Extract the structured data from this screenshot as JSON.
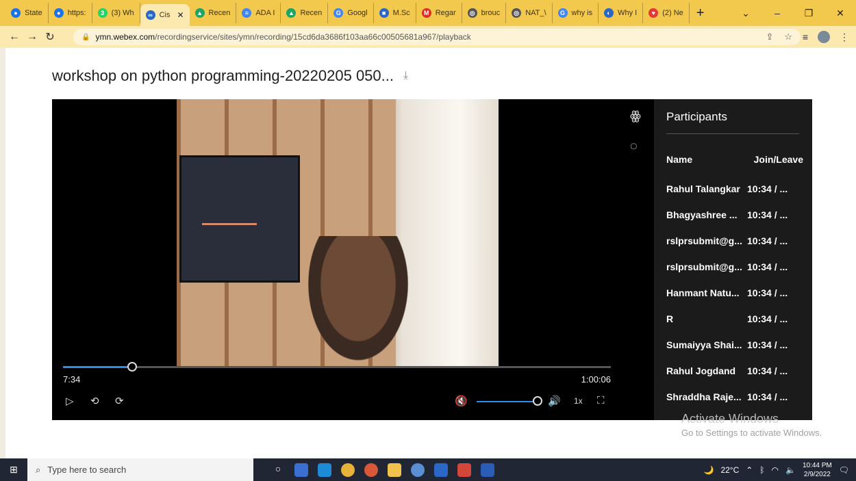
{
  "browser": {
    "tabs": [
      {
        "label": "State",
        "fav_color": "#1a73e8",
        "fav_glyph": "●"
      },
      {
        "label": "https:",
        "fav_color": "#1a73e8",
        "fav_glyph": "●"
      },
      {
        "label": "(3) Wh",
        "fav_color": "#25d366",
        "fav_glyph": "3"
      },
      {
        "label": "Cis",
        "fav_color": "#2b67c6",
        "fav_glyph": "∞",
        "active": true
      },
      {
        "label": "Recen",
        "fav_color": "#1fa463",
        "fav_glyph": "▲"
      },
      {
        "label": "ADA I",
        "fav_color": "#4285f4",
        "fav_glyph": "≡"
      },
      {
        "label": "Recen",
        "fav_color": "#1fa463",
        "fav_glyph": "▲"
      },
      {
        "label": "Googl",
        "fav_color": "#4285f4",
        "fav_glyph": "G"
      },
      {
        "label": "M.Sc",
        "fav_color": "#2b67c6",
        "fav_glyph": "■"
      },
      {
        "label": "Regar",
        "fav_color": "#d93025",
        "fav_glyph": "M"
      },
      {
        "label": "brouc",
        "fav_color": "#555555",
        "fav_glyph": "◎"
      },
      {
        "label": "NAT_\\",
        "fav_color": "#555555",
        "fav_glyph": "◎"
      },
      {
        "label": "why is",
        "fav_color": "#4285f4",
        "fav_glyph": "G"
      },
      {
        "label": "Why I",
        "fav_color": "#2b67c6",
        "fav_glyph": "◐"
      },
      {
        "label": "(2) Ne",
        "fav_color": "#e53935",
        "fav_glyph": "♥"
      }
    ],
    "new_tab": "+",
    "url_host": "ymn.webex.com",
    "url_path": "/recordingservice/sites/ymn/recording/15cd6da3686f103aa66c00505681a967/playback"
  },
  "page": {
    "title": "workshop on python programming-20220205 050...",
    "download_icon": "⤓"
  },
  "player": {
    "current_time": "7:34",
    "total_time": "1:00:06",
    "progress": 0.126,
    "volume": 1.0,
    "speed": "1x"
  },
  "participants": {
    "title": "Participants",
    "col_name": "Name",
    "col_time": "Join/Leave",
    "rows": [
      {
        "name": "Rahul Talangkar",
        "time": "10:34 / ..."
      },
      {
        "name": "Bhagyashree ...",
        "time": "10:34 / ..."
      },
      {
        "name": "rslprsubmit@g...",
        "time": "10:34 / ..."
      },
      {
        "name": "rslprsubmit@g...",
        "time": "10:34 / ..."
      },
      {
        "name": "Hanmant Natu...",
        "time": "10:34 / ..."
      },
      {
        "name": "R",
        "time": "10:34 / ..."
      },
      {
        "name": "Sumaiyya Shai...",
        "time": "10:34 / ..."
      },
      {
        "name": "Rahul Jogdand",
        "time": "10:34 / ..."
      },
      {
        "name": "Shraddha Raje...",
        "time": "10:34 / ..."
      }
    ]
  },
  "watermark": {
    "line1": "Activate Windows",
    "line2": "Go to Settings to activate Windows."
  },
  "taskbar": {
    "search_placeholder": "Type here to search",
    "weather": "22°C",
    "time": "10:44 PM",
    "date": "2/9/2022"
  }
}
